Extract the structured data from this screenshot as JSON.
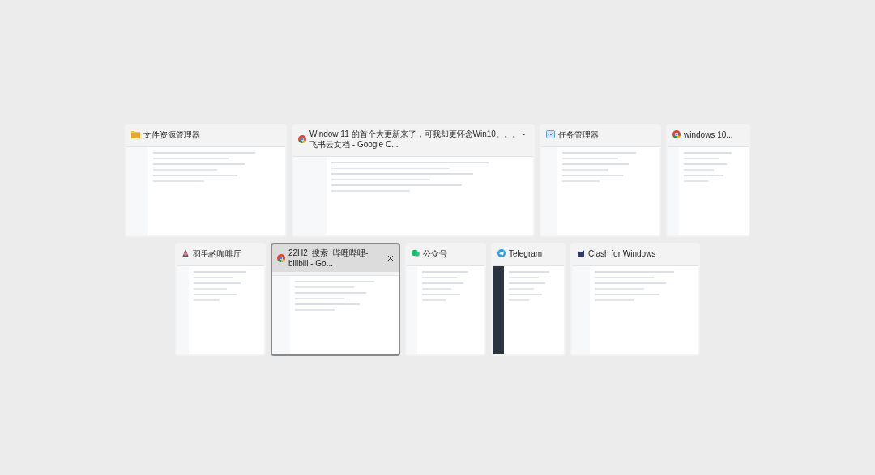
{
  "task_switcher": {
    "rows": [
      {
        "windows": [
          {
            "title": "文件资源管理器",
            "kind": "folder",
            "selected": false
          },
          {
            "title": "Window 11 的首个大更新来了，可我却更怀念Win10。。。 - 飞书云文档 - Google C...",
            "kind": "browser",
            "selected": false
          },
          {
            "title": "任务管理器",
            "kind": "monitor",
            "selected": false
          },
          {
            "title": "windows 10...",
            "kind": "browser",
            "selected": false
          }
        ]
      },
      {
        "windows": [
          {
            "title": "羽毛的咖啡厅",
            "kind": "app",
            "selected": false
          },
          {
            "title": "22H2_搜索_哔哩哔哩-bilibili - Go...",
            "kind": "browser",
            "selected": true
          },
          {
            "title": "公众号",
            "kind": "chat",
            "selected": false
          },
          {
            "title": "Telegram",
            "kind": "plane",
            "selected": false
          },
          {
            "title": "Clash for Windows",
            "kind": "cat",
            "selected": false
          }
        ]
      }
    ]
  }
}
